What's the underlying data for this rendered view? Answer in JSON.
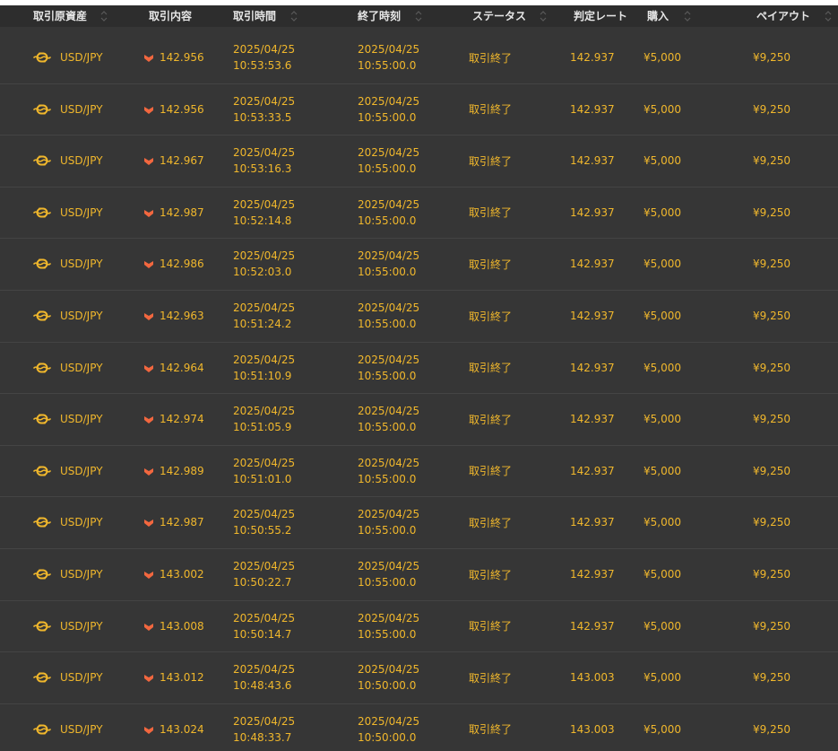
{
  "colors": {
    "background": "#363636",
    "header_background": "#2d2d2d",
    "accent_text": "#f0b72c",
    "header_text": "#e6e6e6",
    "down_arrow": "#f2673f",
    "sort_icon": "#5a5a5a"
  },
  "icons": {
    "asset": "currency-link-icon",
    "direction": "down-arrow-icon",
    "sort": "sort-updown-icon"
  },
  "columns": [
    {
      "key": "asset",
      "label": "取引原資産",
      "sortable": true
    },
    {
      "key": "entry",
      "label": "取引内容",
      "sortable": false
    },
    {
      "key": "time",
      "label": "取引時間",
      "sortable": true
    },
    {
      "key": "end",
      "label": "終了時刻",
      "sortable": true
    },
    {
      "key": "status",
      "label": "ステータス",
      "sortable": true
    },
    {
      "key": "rate",
      "label": "判定レート",
      "sortable": false
    },
    {
      "key": "purchase",
      "label": "購入",
      "sortable": true
    },
    {
      "key": "payout",
      "label": "ペイアウト",
      "sortable": true
    }
  ],
  "rows": [
    {
      "asset": "USD/JPY",
      "entry": "142.956",
      "time_date": "2025/04/25",
      "time_clock": "10:53:53.6",
      "end_date": "2025/04/25",
      "end_clock": "10:55:00.0",
      "status": "取引終了",
      "rate": "142.937",
      "purchase": "¥5,000",
      "payout": "¥9,250"
    },
    {
      "asset": "USD/JPY",
      "entry": "142.956",
      "time_date": "2025/04/25",
      "time_clock": "10:53:33.5",
      "end_date": "2025/04/25",
      "end_clock": "10:55:00.0",
      "status": "取引終了",
      "rate": "142.937",
      "purchase": "¥5,000",
      "payout": "¥9,250"
    },
    {
      "asset": "USD/JPY",
      "entry": "142.967",
      "time_date": "2025/04/25",
      "time_clock": "10:53:16.3",
      "end_date": "2025/04/25",
      "end_clock": "10:55:00.0",
      "status": "取引終了",
      "rate": "142.937",
      "purchase": "¥5,000",
      "payout": "¥9,250"
    },
    {
      "asset": "USD/JPY",
      "entry": "142.987",
      "time_date": "2025/04/25",
      "time_clock": "10:52:14.8",
      "end_date": "2025/04/25",
      "end_clock": "10:55:00.0",
      "status": "取引終了",
      "rate": "142.937",
      "purchase": "¥5,000",
      "payout": "¥9,250"
    },
    {
      "asset": "USD/JPY",
      "entry": "142.986",
      "time_date": "2025/04/25",
      "time_clock": "10:52:03.0",
      "end_date": "2025/04/25",
      "end_clock": "10:55:00.0",
      "status": "取引終了",
      "rate": "142.937",
      "purchase": "¥5,000",
      "payout": "¥9,250"
    },
    {
      "asset": "USD/JPY",
      "entry": "142.963",
      "time_date": "2025/04/25",
      "time_clock": "10:51:24.2",
      "end_date": "2025/04/25",
      "end_clock": "10:55:00.0",
      "status": "取引終了",
      "rate": "142.937",
      "purchase": "¥5,000",
      "payout": "¥9,250"
    },
    {
      "asset": "USD/JPY",
      "entry": "142.964",
      "time_date": "2025/04/25",
      "time_clock": "10:51:10.9",
      "end_date": "2025/04/25",
      "end_clock": "10:55:00.0",
      "status": "取引終了",
      "rate": "142.937",
      "purchase": "¥5,000",
      "payout": "¥9,250"
    },
    {
      "asset": "USD/JPY",
      "entry": "142.974",
      "time_date": "2025/04/25",
      "time_clock": "10:51:05.9",
      "end_date": "2025/04/25",
      "end_clock": "10:55:00.0",
      "status": "取引終了",
      "rate": "142.937",
      "purchase": "¥5,000",
      "payout": "¥9,250"
    },
    {
      "asset": "USD/JPY",
      "entry": "142.989",
      "time_date": "2025/04/25",
      "time_clock": "10:51:01.0",
      "end_date": "2025/04/25",
      "end_clock": "10:55:00.0",
      "status": "取引終了",
      "rate": "142.937",
      "purchase": "¥5,000",
      "payout": "¥9,250"
    },
    {
      "asset": "USD/JPY",
      "entry": "142.987",
      "time_date": "2025/04/25",
      "time_clock": "10:50:55.2",
      "end_date": "2025/04/25",
      "end_clock": "10:55:00.0",
      "status": "取引終了",
      "rate": "142.937",
      "purchase": "¥5,000",
      "payout": "¥9,250"
    },
    {
      "asset": "USD/JPY",
      "entry": "143.002",
      "time_date": "2025/04/25",
      "time_clock": "10:50:22.7",
      "end_date": "2025/04/25",
      "end_clock": "10:55:00.0",
      "status": "取引終了",
      "rate": "142.937",
      "purchase": "¥5,000",
      "payout": "¥9,250"
    },
    {
      "asset": "USD/JPY",
      "entry": "143.008",
      "time_date": "2025/04/25",
      "time_clock": "10:50:14.7",
      "end_date": "2025/04/25",
      "end_clock": "10:55:00.0",
      "status": "取引終了",
      "rate": "142.937",
      "purchase": "¥5,000",
      "payout": "¥9,250"
    },
    {
      "asset": "USD/JPY",
      "entry": "143.012",
      "time_date": "2025/04/25",
      "time_clock": "10:48:43.6",
      "end_date": "2025/04/25",
      "end_clock": "10:50:00.0",
      "status": "取引終了",
      "rate": "143.003",
      "purchase": "¥5,000",
      "payout": "¥9,250"
    },
    {
      "asset": "USD/JPY",
      "entry": "143.024",
      "time_date": "2025/04/25",
      "time_clock": "10:48:33.7",
      "end_date": "2025/04/25",
      "end_clock": "10:50:00.0",
      "status": "取引終了",
      "rate": "143.003",
      "purchase": "¥5,000",
      "payout": "¥9,250"
    }
  ]
}
